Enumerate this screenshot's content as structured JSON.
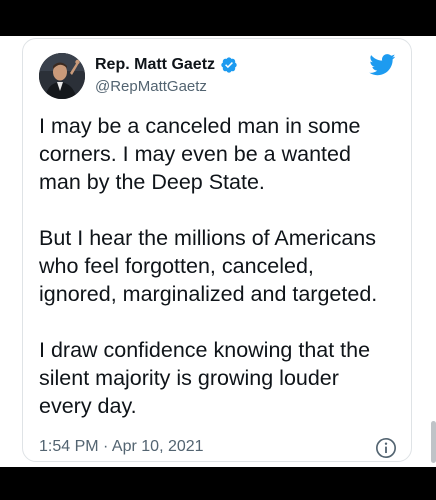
{
  "tweet": {
    "display_name": "Rep. Matt Gaetz",
    "handle": "@RepMattGaetz",
    "paragraphs": [
      "I may be a canceled man in some\ncorners. I may even be a wanted\nman by the Deep State.",
      "But I hear the millions of Americans\nwho feel forgotten, canceled,\nignored, marginalized and targeted.",
      "I draw confidence knowing that the\nsilent majority is growing louder\nevery day."
    ],
    "timestamp": "1:54 PM · Apr 10, 2021",
    "verified": true
  },
  "icons": {
    "verified": "verified-badge-icon",
    "brand": "twitter-bird-icon",
    "info": "info-icon"
  },
  "colors": {
    "twitter_blue": "#1d9bf0",
    "text_primary": "#0f1419",
    "text_secondary": "#536471",
    "border": "#dfe3e6"
  }
}
